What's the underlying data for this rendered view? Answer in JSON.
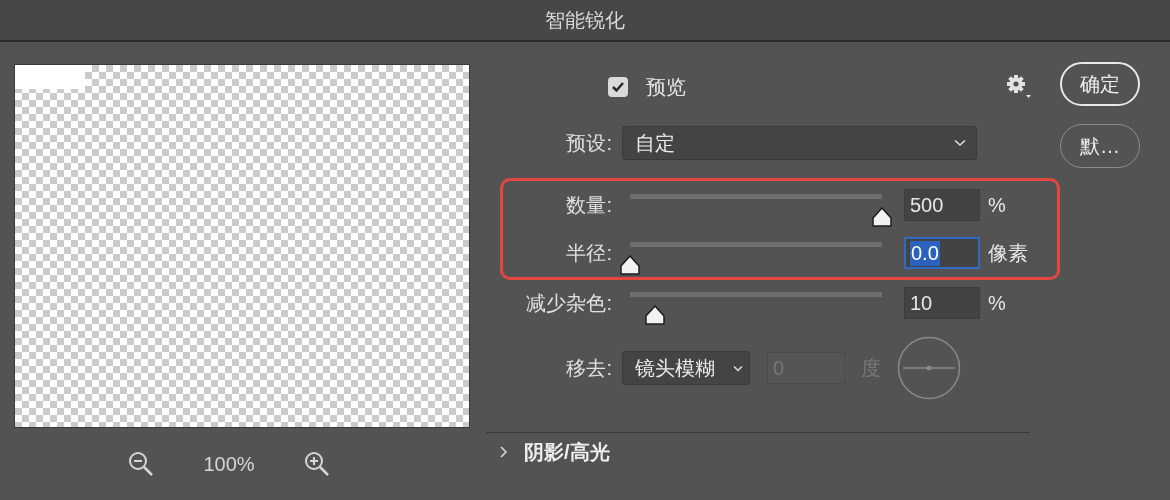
{
  "window": {
    "title": "智能锐化"
  },
  "preview": {
    "zoom": "100%"
  },
  "preview_option": {
    "label": "预览",
    "checked": true
  },
  "preset": {
    "label": "预设:",
    "value": "自定"
  },
  "sliders": [
    {
      "label": "数量:",
      "level": 1,
      "value": "500",
      "unit": "%",
      "highlighted": true,
      "value_selected": false
    },
    {
      "label": "半径:",
      "level": 0,
      "value": "0.0",
      "unit": "像素",
      "highlighted": true,
      "value_selected": true
    },
    {
      "label": "减少杂色:",
      "level": 0.1,
      "value": "10",
      "unit": "%",
      "highlighted": false,
      "value_selected": false
    }
  ],
  "remove": {
    "label": "移去:",
    "value": "镜头模糊",
    "angle": "0",
    "angle_unit": "度",
    "angle_disabled": true
  },
  "section": {
    "label": "阴影/高光",
    "expanded": false
  },
  "buttons": [
    {
      "label": "确定",
      "default": true
    },
    {
      "label": "默…",
      "default": false
    }
  ]
}
